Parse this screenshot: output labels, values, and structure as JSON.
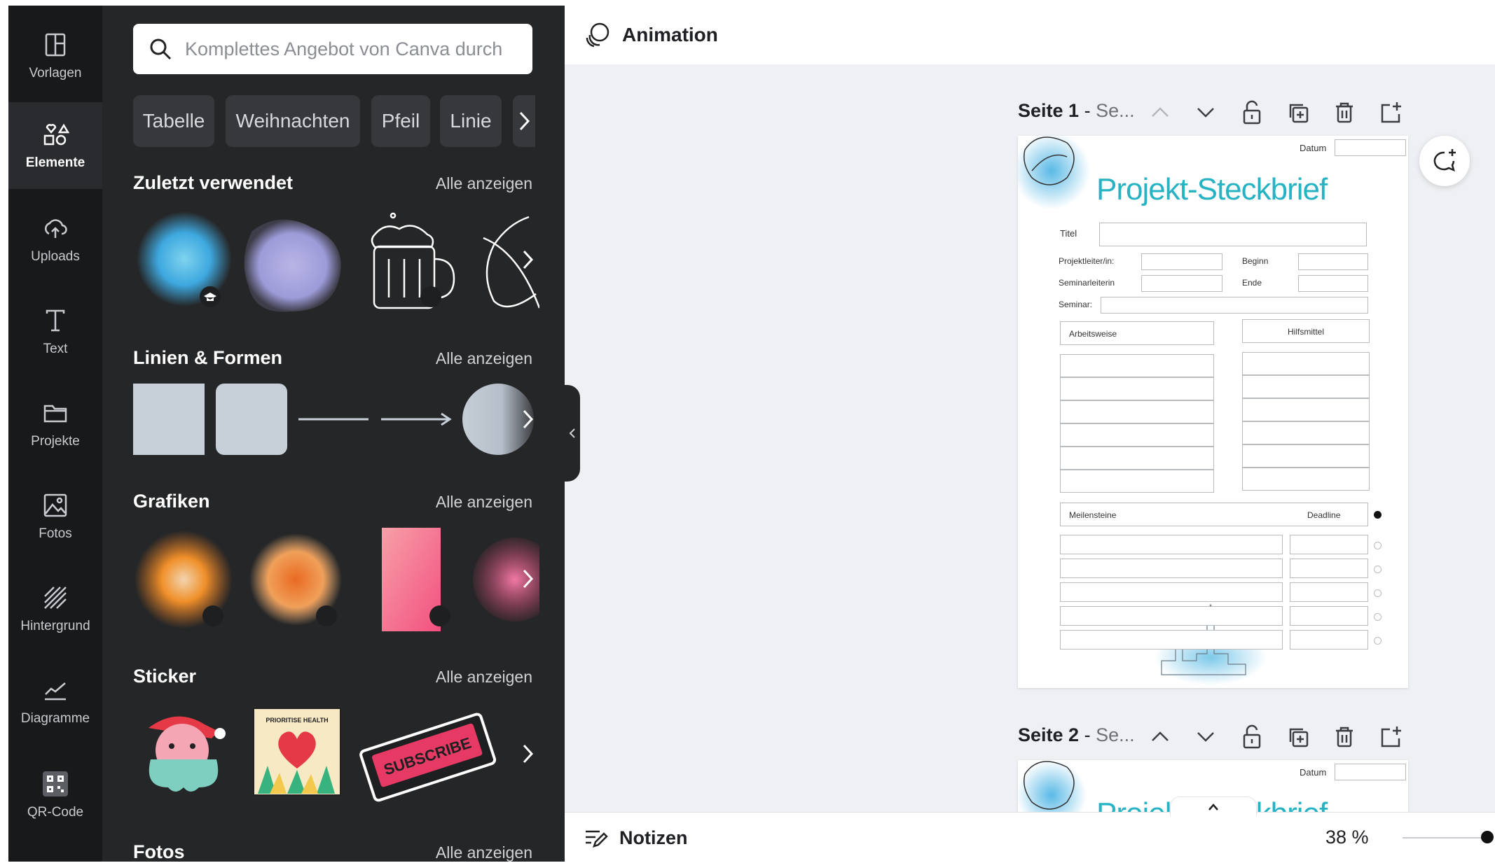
{
  "rail": {
    "items": [
      {
        "label": "Vorlagen",
        "icon": "template-icon"
      },
      {
        "label": "Elemente",
        "icon": "elements-icon",
        "active": true
      },
      {
        "label": "Uploads",
        "icon": "upload-cloud-icon"
      },
      {
        "label": "Text",
        "icon": "text-icon"
      },
      {
        "label": "Projekte",
        "icon": "folder-icon"
      },
      {
        "label": "Fotos",
        "icon": "image-icon"
      },
      {
        "label": "Hintergrund",
        "icon": "background-pattern-icon"
      },
      {
        "label": "Diagramme",
        "icon": "chart-icon"
      },
      {
        "label": "QR-Code",
        "icon": "qr-code-icon"
      }
    ]
  },
  "search": {
    "placeholder": "Komplettes Angebot von Canva durch"
  },
  "chips": [
    "Tabelle",
    "Weihnachten",
    "Pfeil",
    "Linie"
  ],
  "sections": {
    "recent": {
      "title": "Zuletzt verwendet",
      "link": "Alle anzeigen"
    },
    "shapes": {
      "title": "Linien & Formen",
      "link": "Alle anzeigen"
    },
    "graphics": {
      "title": "Grafiken",
      "link": "Alle anzeigen"
    },
    "stickers": {
      "title": "Sticker",
      "link": "Alle anzeigen"
    },
    "photos": {
      "title": "Fotos",
      "link": "Alle anzeigen"
    }
  },
  "stickers": {
    "poster_text": "PRIORITISE HEALTH",
    "subscribe_text": "SUBSCRIBE"
  },
  "topbar": {
    "animation_label": "Animation"
  },
  "pages": [
    {
      "label": "Seite 1",
      "suffix": "Se..."
    },
    {
      "label": "Seite 2",
      "suffix": "Se..."
    }
  ],
  "document": {
    "title": "Projekt-Steckbrief",
    "datum": "Datum",
    "titel": "Titel",
    "projektleiter": "Projektleiter/in:",
    "beginn": "Beginn",
    "seminarleiterin": "Seminarleiterin",
    "ende": "Ende",
    "seminar": "Seminar:",
    "arbeitsweise": "Arbeitsweise",
    "hilfsmittel": "Hilfsmittel",
    "meilensteine": "Meilensteine",
    "deadline": "Deadline"
  },
  "bottombar": {
    "notes_label": "Notizen",
    "zoom": "38 %"
  },
  "colors": {
    "accent_teal": "#27b3c3",
    "panel_bg": "#252627",
    "rail_bg": "#18191b"
  }
}
